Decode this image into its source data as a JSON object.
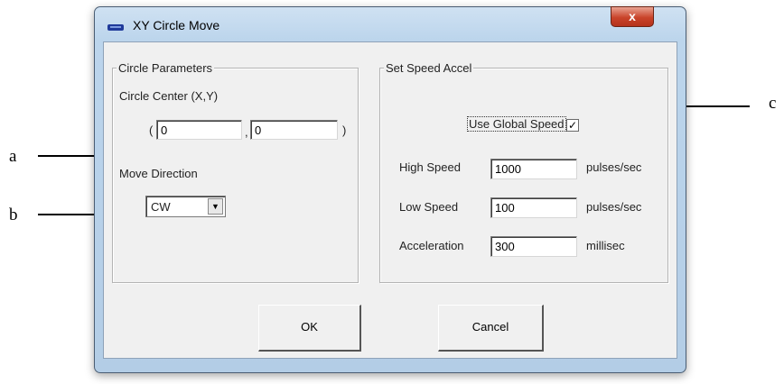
{
  "window": {
    "title": "XY Circle Move",
    "close_glyph": "x"
  },
  "circle_parameters": {
    "group_label": "Circle Parameters",
    "center_label": "Circle Center (X,Y)",
    "paren_open": "(",
    "comma": ",",
    "paren_close": ")",
    "center_x": "0",
    "center_y": "0",
    "direction_label": "Move Direction",
    "direction_value": "CW"
  },
  "speed_accel": {
    "group_label": "Set Speed Accel",
    "use_global_label": "Use Global Speed",
    "use_global_checked": true,
    "high_speed_label": "High Speed",
    "high_speed_value": "1000",
    "high_speed_unit": "pulses/sec",
    "low_speed_label": "Low Speed",
    "low_speed_value": "100",
    "low_speed_unit": "pulses/sec",
    "acceleration_label": "Acceleration",
    "acceleration_value": "300",
    "acceleration_unit": "millisec"
  },
  "buttons": {
    "ok": "OK",
    "cancel": "Cancel"
  },
  "callouts": {
    "a": "a",
    "b": "b",
    "c": "c"
  },
  "icons": {
    "close": "close-icon",
    "app": "app-icon",
    "dropdown": "chevron-down-icon",
    "check": "check-icon"
  }
}
